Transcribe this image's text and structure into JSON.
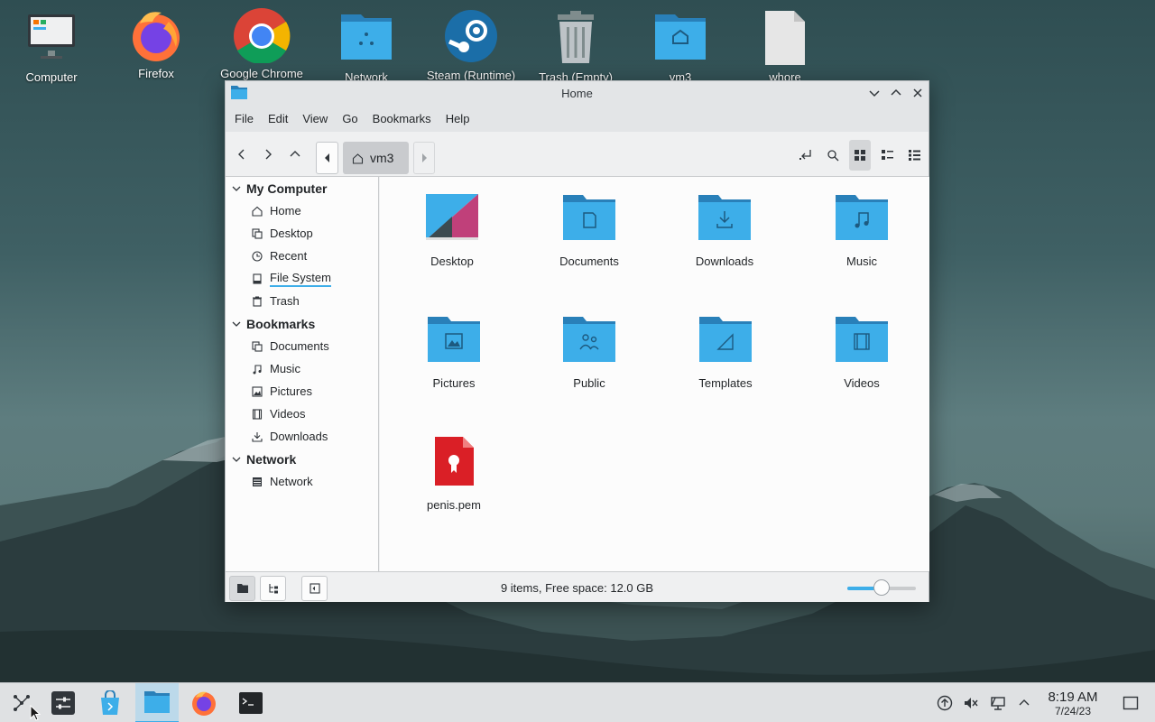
{
  "desktop": {
    "icons": [
      {
        "label": "Computer",
        "icon": "computer-icon"
      },
      {
        "label": "Firefox",
        "icon": "firefox-icon"
      },
      {
        "label": "Google Chrome",
        "icon": "chrome-icon"
      },
      {
        "label": "Network",
        "icon": "network-folder-icon"
      },
      {
        "label": "Steam (Runtime)",
        "icon": "steam-icon"
      },
      {
        "label": "Trash (Empty)",
        "icon": "trash-icon"
      },
      {
        "label": "vm3",
        "icon": "home-folder-icon"
      },
      {
        "label": "whore",
        "icon": "file-icon"
      }
    ]
  },
  "window": {
    "title": "Home",
    "menu": [
      "File",
      "Edit",
      "View",
      "Go",
      "Bookmarks",
      "Help"
    ],
    "breadcrumb": "vm3",
    "sidebar": {
      "sections": [
        {
          "title": "My Computer",
          "items": [
            {
              "label": "Home",
              "icon": "home-icon"
            },
            {
              "label": "Desktop",
              "icon": "desktop-icon"
            },
            {
              "label": "Recent",
              "icon": "clock-icon"
            },
            {
              "label": "File System",
              "icon": "drive-icon"
            },
            {
              "label": "Trash",
              "icon": "trash-icon"
            }
          ]
        },
        {
          "title": "Bookmarks",
          "items": [
            {
              "label": "Documents",
              "icon": "documents-icon"
            },
            {
              "label": "Music",
              "icon": "music-icon"
            },
            {
              "label": "Pictures",
              "icon": "pictures-icon"
            },
            {
              "label": "Videos",
              "icon": "videos-icon"
            },
            {
              "label": "Downloads",
              "icon": "downloads-icon"
            }
          ]
        },
        {
          "title": "Network",
          "items": [
            {
              "label": "Network",
              "icon": "network-icon"
            }
          ]
        }
      ]
    },
    "files": [
      {
        "label": "Desktop",
        "icon": "desktop-folder-icon"
      },
      {
        "label": "Documents",
        "icon": "documents-folder-icon"
      },
      {
        "label": "Downloads",
        "icon": "downloads-folder-icon"
      },
      {
        "label": "Music",
        "icon": "music-folder-icon"
      },
      {
        "label": "Pictures",
        "icon": "pictures-folder-icon"
      },
      {
        "label": "Public",
        "icon": "public-folder-icon"
      },
      {
        "label": "Templates",
        "icon": "templates-folder-icon"
      },
      {
        "label": "Videos",
        "icon": "videos-folder-icon"
      },
      {
        "label": "penis.pem",
        "icon": "certificate-file-icon"
      }
    ],
    "status": "9 items, Free space: 12.0 GB",
    "zoom_level": 0.5
  },
  "taskbar": {
    "time": "8:19 AM",
    "date": "7/24/23"
  },
  "colors": {
    "accent": "#3daee9",
    "folder": "#3daee9",
    "folder_tab": "#2980b9"
  }
}
